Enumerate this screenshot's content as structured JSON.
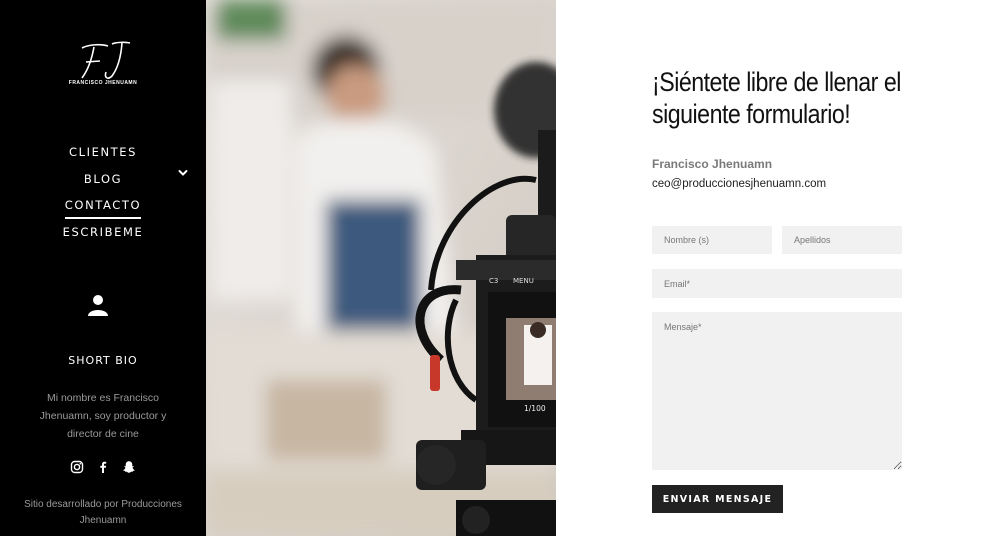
{
  "sidebar": {
    "logo_monogram": "FJ",
    "logo_subtitle": "FRANCISCO JHENUAMN",
    "nav": [
      {
        "label": "CLIENTES"
      },
      {
        "label": "BLOG"
      },
      {
        "label": "CONTACTO"
      },
      {
        "label": "ESCRIBEME"
      }
    ],
    "active_item": "CONTACTO",
    "bio_title": "SHORT BIO",
    "bio_text": "Mi nombre es Francisco Jhenuamn, soy productor y director de cine",
    "social_icons": [
      "instagram-icon",
      "facebook-icon",
      "snapchat-icon"
    ],
    "credit": "Sitio desarrollado por Producciones Jhenuamn"
  },
  "photo": {
    "camera_mode": "C3",
    "camera_menu": "MENU",
    "camera_counter": "1/100"
  },
  "main": {
    "title": "¡Siéntete libre de llenar el siguiente formulario!",
    "contact_name": "Francisco Jhenuamn",
    "contact_email": "ceo@produccionesjhenuamn.com",
    "form": {
      "nombre_placeholder": "Nombre (s)",
      "apellidos_placeholder": "Apellidos",
      "email_placeholder": "Email*",
      "mensaje_placeholder": "Mensaje*",
      "submit_label": "ENVIAR MENSAJE"
    }
  },
  "colors": {
    "sidebar_bg": "#000000",
    "input_bg": "#f1f1f1",
    "button_bg": "#222222",
    "muted_text": "#9a9a9a"
  }
}
